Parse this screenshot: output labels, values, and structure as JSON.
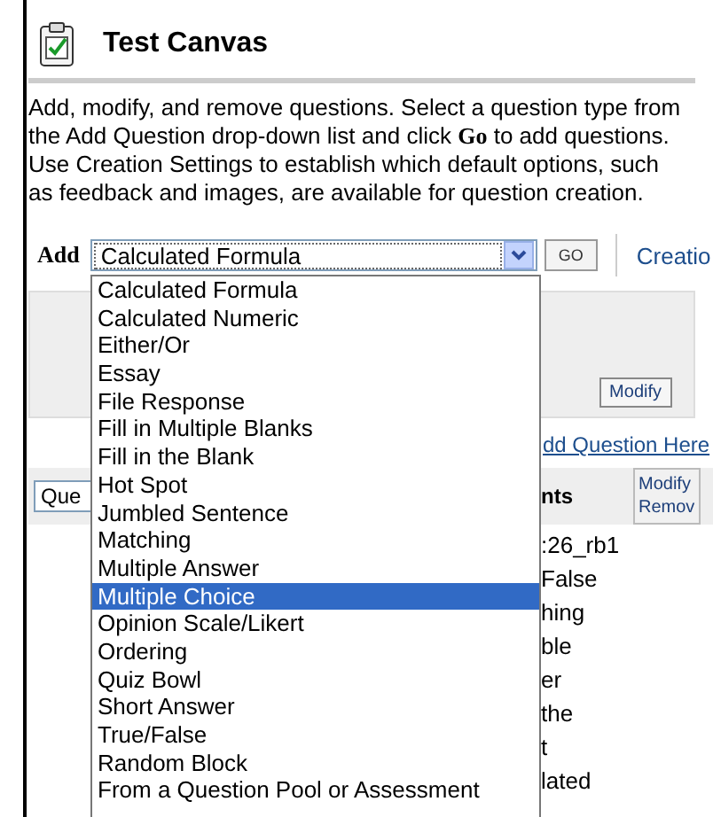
{
  "header": {
    "title": "Test Canvas"
  },
  "instructions": "Add, modify, and remove questions. Select a question type from the Add Question drop-down list and click **Go** to add questions. Use Creation Settings to establish which default options, such as feedback and images, are available for question creation.",
  "toolbar": {
    "add_label": "Add",
    "select_value": "Calculated Formula",
    "go_button": "GO",
    "creation_link": "Creatio"
  },
  "dropdown": {
    "expanded": true,
    "options": [
      {
        "label": "Calculated Formula",
        "selected": false
      },
      {
        "label": "Calculated Numeric",
        "selected": false
      },
      {
        "label": "Either/Or",
        "selected": false
      },
      {
        "label": "Essay",
        "selected": false
      },
      {
        "label": "File Response",
        "selected": false
      },
      {
        "label": "Fill in Multiple Blanks",
        "selected": false
      },
      {
        "label": "Fill in the Blank",
        "selected": false
      },
      {
        "label": "Hot Spot",
        "selected": false
      },
      {
        "label": "Jumbled Sentence",
        "selected": false
      },
      {
        "label": "Matching",
        "selected": false
      },
      {
        "label": "Multiple Answer",
        "selected": false
      },
      {
        "label": "Multiple Choice",
        "selected": true
      },
      {
        "label": "Opinion Scale/Likert",
        "selected": false
      },
      {
        "label": "Ordering",
        "selected": false
      },
      {
        "label": "Quiz Bowl",
        "selected": false
      },
      {
        "label": "Short Answer",
        "selected": false
      },
      {
        "label": "True/False",
        "selected": false
      },
      {
        "label": "Random Block",
        "selected": false
      },
      {
        "label": "From a Question Pool or Assessment",
        "selected": false
      }
    ]
  },
  "panel": {
    "modify_button": "Modify"
  },
  "add_question_link": "dd Question Here",
  "table": {
    "field": "Que",
    "column_2": "nts",
    "action_button": [
      "Modify",
      "Remov"
    ],
    "rows": [
      ":26_rb1",
      "False",
      "hing",
      "ble",
      "er",
      "the",
      "t",
      "lated"
    ]
  }
}
